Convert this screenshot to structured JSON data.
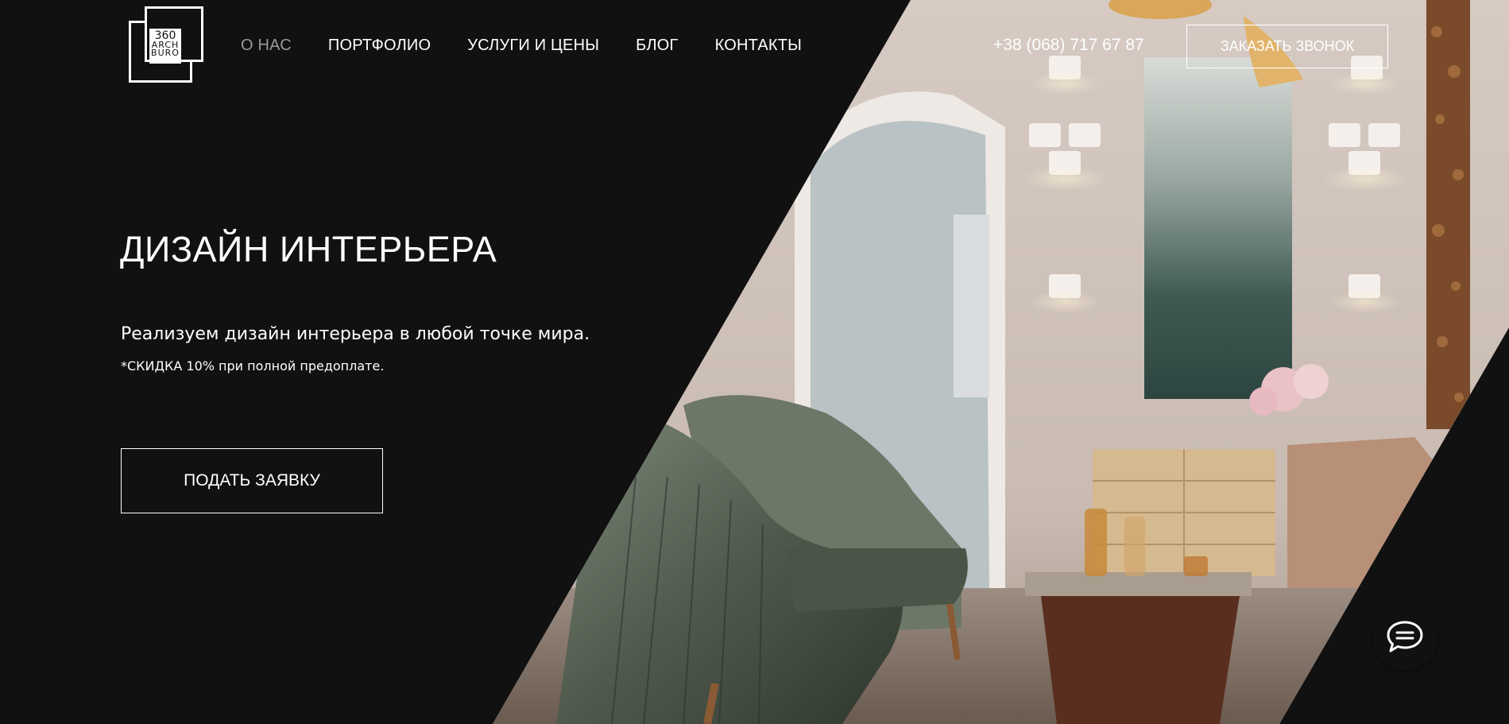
{
  "brand": {
    "logo_lines": [
      "360",
      "ARCH",
      "BURO"
    ]
  },
  "nav": {
    "items": [
      {
        "label": "О НАС",
        "active": true
      },
      {
        "label": "ПОРТФОЛИО",
        "active": false
      },
      {
        "label": "УСЛУГИ И ЦЕНЫ",
        "active": false
      },
      {
        "label": "БЛОГ",
        "active": false
      },
      {
        "label": "КОНТАКТЫ",
        "active": false
      }
    ]
  },
  "header": {
    "phone": "+38 (068) 717 67 87",
    "call_button": "ЗАКАЗАТЬ ЗВОНОК"
  },
  "hero": {
    "title": "ДИЗАЙН ИНТЕРЬЕРА",
    "subtitle": "Реализуем дизайн интерьера в любой точке мира.",
    "note": "*СКИДКА 10% при полной предоплате.",
    "cta": "ПОДАТЬ ЗАЯВКУ"
  },
  "chat": {
    "icon": "chat-bubble-icon"
  },
  "colors": {
    "background": "#111111",
    "text": "#ffffff",
    "nav_active": "#9a9a9a"
  }
}
